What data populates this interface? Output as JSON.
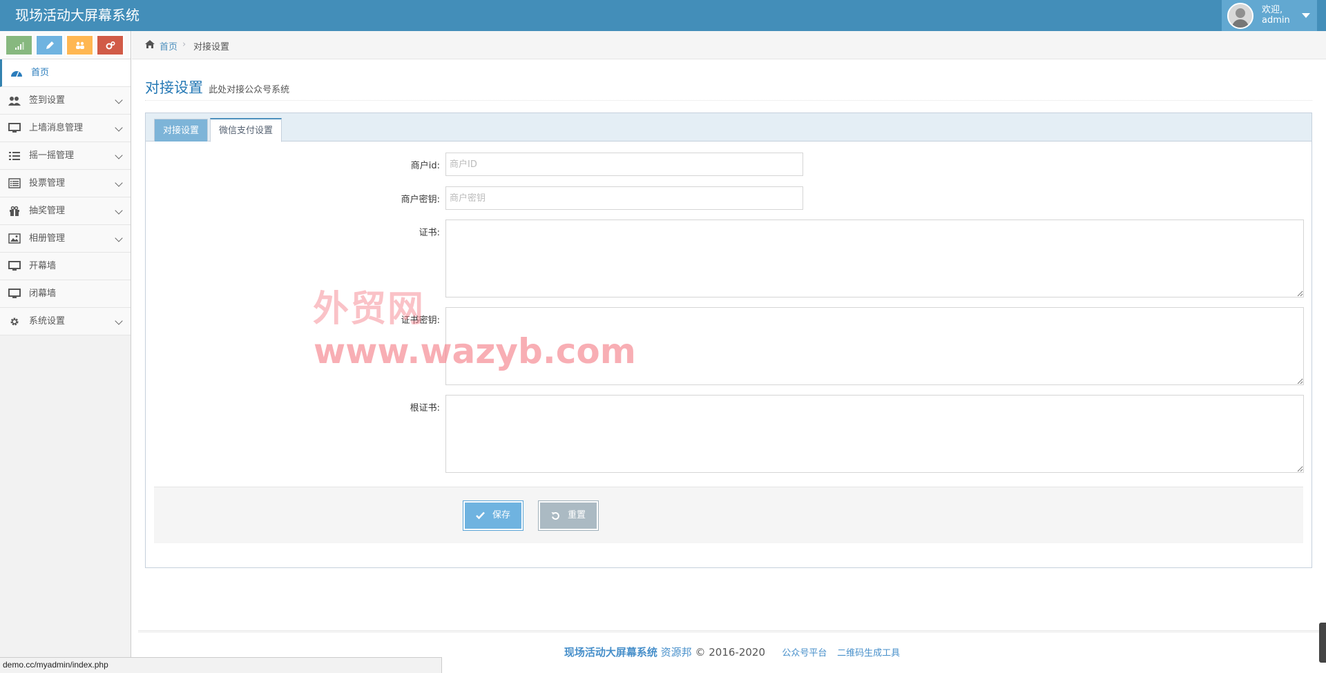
{
  "app": {
    "title": "现场活动大屏幕系统"
  },
  "user": {
    "greeting": "欢迎,",
    "name": "admin"
  },
  "sidebar": {
    "shortcuts": [
      {
        "icon": "signal-icon",
        "color": "#87b87f"
      },
      {
        "icon": "pencil-icon",
        "color": "#6fb3e0"
      },
      {
        "icon": "group-icon",
        "color": "#ffb752"
      },
      {
        "icon": "cogs-icon",
        "color": "#d15b47"
      }
    ],
    "items": [
      {
        "label": "首页",
        "icon": "dashboard-icon",
        "active": true,
        "has_submenu": false
      },
      {
        "label": "签到设置",
        "icon": "users-icon",
        "active": false,
        "has_submenu": true
      },
      {
        "label": "上墙消息管理",
        "icon": "desktop-icon",
        "active": false,
        "has_submenu": true
      },
      {
        "label": "摇一摇管理",
        "icon": "list-icon",
        "active": false,
        "has_submenu": true
      },
      {
        "label": "投票管理",
        "icon": "list-alt-icon",
        "active": false,
        "has_submenu": true
      },
      {
        "label": "抽奖管理",
        "icon": "gift-icon",
        "active": false,
        "has_submenu": true
      },
      {
        "label": "相册管理",
        "icon": "picture-icon",
        "active": false,
        "has_submenu": true
      },
      {
        "label": "开幕墙",
        "icon": "desktop-icon",
        "active": false,
        "has_submenu": false
      },
      {
        "label": "闭幕墙",
        "icon": "desktop-icon",
        "active": false,
        "has_submenu": false
      },
      {
        "label": "系统设置",
        "icon": "cog-icon",
        "active": false,
        "has_submenu": true
      }
    ]
  },
  "breadcrumb": {
    "home": "首页",
    "separator": "›",
    "current": "对接设置"
  },
  "page": {
    "title": "对接设置",
    "subtitle": "此处对接公众号系统"
  },
  "tabs": [
    {
      "label": "对接设置",
      "active": false
    },
    {
      "label": "微信支付设置",
      "active": true
    }
  ],
  "form": {
    "merchant_id": {
      "label": "商户id:",
      "placeholder": "商户ID",
      "value": ""
    },
    "merchant_key": {
      "label": "商户密钥:",
      "placeholder": "商户密钥",
      "value": ""
    },
    "cert": {
      "label": "证书:",
      "value": ""
    },
    "cert_key": {
      "label": "证书密钥:",
      "value": ""
    },
    "root_cert": {
      "label": "根证书:",
      "value": ""
    },
    "save_label": "保存",
    "reset_label": "重置"
  },
  "watermark": {
    "line1": "外贸网",
    "line2": "www.wazyb.com"
  },
  "footer": {
    "brand": "现场活动大屏幕系统",
    "source": "资源邦",
    "copyright": "© 2016-2020",
    "links": [
      "公众号平台",
      "二维码生成工具"
    ]
  },
  "status_bar": {
    "url": "demo.cc/myadmin/index.php"
  },
  "colors": {
    "navbar": "#438eb9",
    "accent": "#2679b5",
    "save_button": "#6fb3e0",
    "reset_button": "#abbac3"
  }
}
